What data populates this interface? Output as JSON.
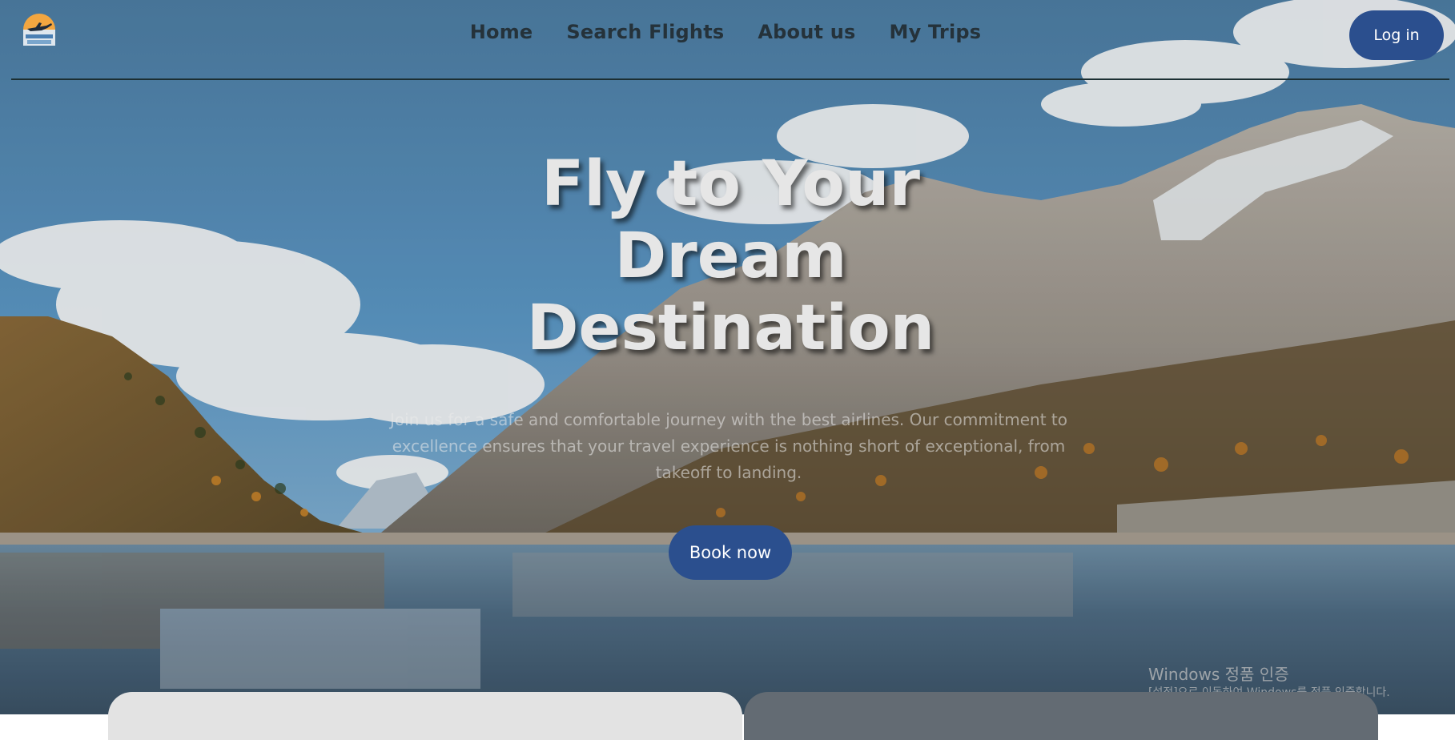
{
  "nav": {
    "links": [
      "Home",
      "Search Flights",
      "About us",
      "My Trips"
    ],
    "login_label": "Log in",
    "logo_icon": "airplane-sunset-logo-icon"
  },
  "hero": {
    "title": "Fly to Your Dream Destination",
    "subtitle": "Join us for a safe and comfortable journey with the best airlines. Our commitment to excellence ensures that your travel experience is nothing short of exceptional, from takeoff to landing.",
    "cta_label": "Book now"
  },
  "watermark": {
    "title": "Windows 정품 인증",
    "subtitle": "[설정]으로 이동하여 Windows를 정품 인증합니다."
  },
  "colors": {
    "accent": "#2b4f8e",
    "nav_text": "#25323a",
    "card_light": "#e3e3e3",
    "card_dark": "#636b73"
  }
}
